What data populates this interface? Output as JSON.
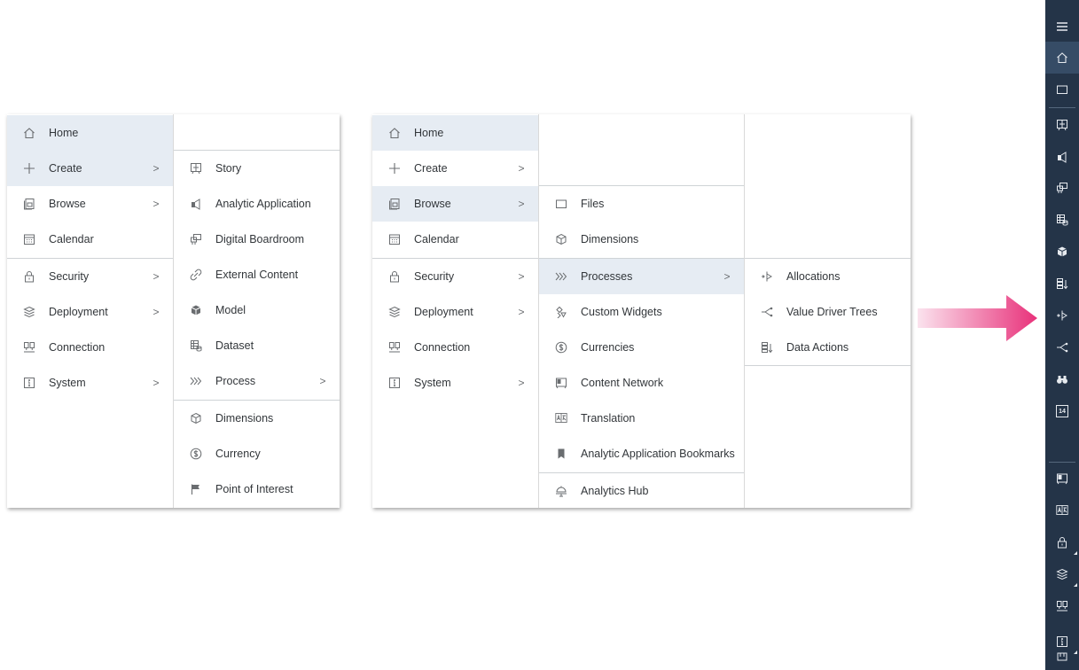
{
  "left_menu": {
    "main": [
      {
        "label": "Home",
        "icon": "home-icon"
      },
      {
        "label": "Create",
        "icon": "plus-icon",
        "chevron": ">"
      },
      {
        "label": "Browse",
        "icon": "browse-icon",
        "chevron": ">"
      },
      {
        "label": "Calendar",
        "icon": "calendar-icon"
      },
      {
        "label": "Security",
        "icon": "lock-icon",
        "chevron": ">"
      },
      {
        "label": "Deployment",
        "icon": "deployment-icon",
        "chevron": ">"
      },
      {
        "label": "Connection",
        "icon": "connection-icon"
      },
      {
        "label": "System",
        "icon": "info-icon",
        "chevron": ">"
      }
    ],
    "create_submenu": [
      {
        "label": "Story",
        "icon": "story-icon"
      },
      {
        "label": "Analytic Application",
        "icon": "analytic-application-icon"
      },
      {
        "label": "Digital Boardroom",
        "icon": "boardroom-icon"
      },
      {
        "label": "External Content",
        "icon": "link-icon"
      },
      {
        "label": "Model",
        "icon": "model-cube-icon"
      },
      {
        "label": "Dataset",
        "icon": "dataset-icon"
      },
      {
        "label": "Process",
        "icon": "process-chevrons-icon",
        "chevron": ">"
      },
      {
        "label": "Dimensions",
        "icon": "dimensions-icon"
      },
      {
        "label": "Currency",
        "icon": "currency-icon"
      },
      {
        "label": "Point of Interest",
        "icon": "flag-icon"
      }
    ]
  },
  "right_menu": {
    "main": [
      {
        "label": "Home",
        "icon": "home-icon"
      },
      {
        "label": "Create",
        "icon": "plus-icon",
        "chevron": ">"
      },
      {
        "label": "Browse",
        "icon": "browse-icon",
        "chevron": ">"
      },
      {
        "label": "Calendar",
        "icon": "calendar-icon"
      },
      {
        "label": "Security",
        "icon": "lock-icon",
        "chevron": ">"
      },
      {
        "label": "Deployment",
        "icon": "deployment-icon",
        "chevron": ">"
      },
      {
        "label": "Connection",
        "icon": "connection-icon"
      },
      {
        "label": "System",
        "icon": "info-icon",
        "chevron": ">"
      }
    ],
    "browse_submenu": [
      {
        "label": "Files",
        "icon": "folder-icon"
      },
      {
        "label": "Dimensions",
        "icon": "dimensions-icon"
      },
      {
        "label": "Processes",
        "icon": "process-chevrons-icon",
        "chevron": ">"
      },
      {
        "label": "Custom Widgets",
        "icon": "custom-widgets-icon"
      },
      {
        "label": "Currencies",
        "icon": "currency-icon"
      },
      {
        "label": "Content Network",
        "icon": "content-network-icon"
      },
      {
        "label": "Translation",
        "icon": "translation-icon"
      },
      {
        "label": "Analytic Application Bookmarks",
        "icon": "bookmark-icon"
      },
      {
        "label": "Analytics Hub",
        "icon": "analytics-hub-icon"
      }
    ],
    "processes_submenu": [
      {
        "label": "Allocations",
        "icon": "allocations-icon"
      },
      {
        "label": "Value Driver Trees",
        "icon": "value-driver-tree-icon"
      },
      {
        "label": "Data Actions",
        "icon": "data-actions-icon"
      }
    ]
  },
  "arrow": {
    "from_color": "#fbe3ee",
    "to_color": "#e8317a"
  },
  "side_rail": {
    "background": "#243448",
    "icons": [
      "hamburger-menu-icon",
      "home-icon",
      "folder-icon",
      "story-icon",
      "analytic-application-icon",
      "boardroom-icon",
      "dataset-icon",
      "model-cube-icon",
      "data-actions-icon",
      "allocations-icon",
      "value-driver-tree-icon",
      "binoculars-icon",
      "calendar-14-icon",
      "content-network-icon",
      "translation-icon",
      "lock-icon",
      "deployment-icon",
      "connection-icon",
      "info-icon"
    ],
    "calendar_day": "14"
  }
}
